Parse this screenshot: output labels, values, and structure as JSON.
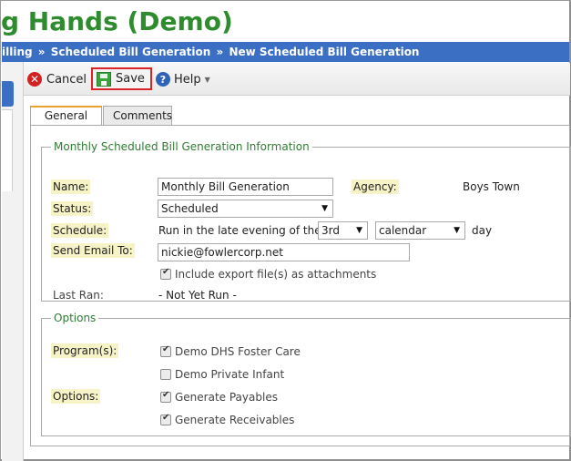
{
  "app": {
    "title": "g Hands (Demo)"
  },
  "breadcrumb": [
    {
      "label": "illing"
    },
    {
      "label": "Scheduled Bill Generation"
    },
    {
      "label": "New Scheduled Bill Generation"
    }
  ],
  "breadcrumb_sep": "»",
  "toolbar": {
    "cancel_label": "Cancel",
    "save_label": "Save",
    "help_label": "Help",
    "cancel_icon": "x-circle-icon",
    "save_icon": "floppy-disk-icon",
    "help_icon": "question-circle-icon",
    "highlight_color": "#d9252a"
  },
  "tabs": [
    {
      "label": "General",
      "active": true
    },
    {
      "label": "Comments",
      "active": false
    }
  ],
  "info": {
    "legend": "Monthly Scheduled Bill Generation Information",
    "name_label": "Name:",
    "name_value": "Monthly Bill Generation",
    "agency_label": "Agency:",
    "agency_value": "Boys Town",
    "status_label": "Status:",
    "status_value": "Scheduled",
    "schedule_label": "Schedule:",
    "schedule_prefix": "Run in the late evening of the",
    "schedule_day": "3rd",
    "schedule_type": "calendar",
    "schedule_suffix": "day",
    "email_label": "Send Email To:",
    "email_value": "nickie@fowlercorp.net",
    "attach_label": "Include export file(s) as attachments",
    "attach_checked": true,
    "last_ran_label": "Last Ran:",
    "last_ran_value": "- Not Yet Run -"
  },
  "options": {
    "legend": "Options",
    "programs_label": "Program(s):",
    "programs": [
      {
        "label": "Demo DHS Foster Care",
        "checked": true
      },
      {
        "label": "Demo Private Infant",
        "checked": false
      }
    ],
    "options_label": "Options:",
    "option_items": [
      {
        "label": "Generate Payables",
        "checked": true
      },
      {
        "label": "Generate Receivables",
        "checked": true
      }
    ]
  },
  "colors": {
    "accent_blue": "#3b6fc4",
    "title_green": "#2e8b2e",
    "required_bg": "#f6f3c7",
    "tab_active_border": "#e7a32b"
  }
}
